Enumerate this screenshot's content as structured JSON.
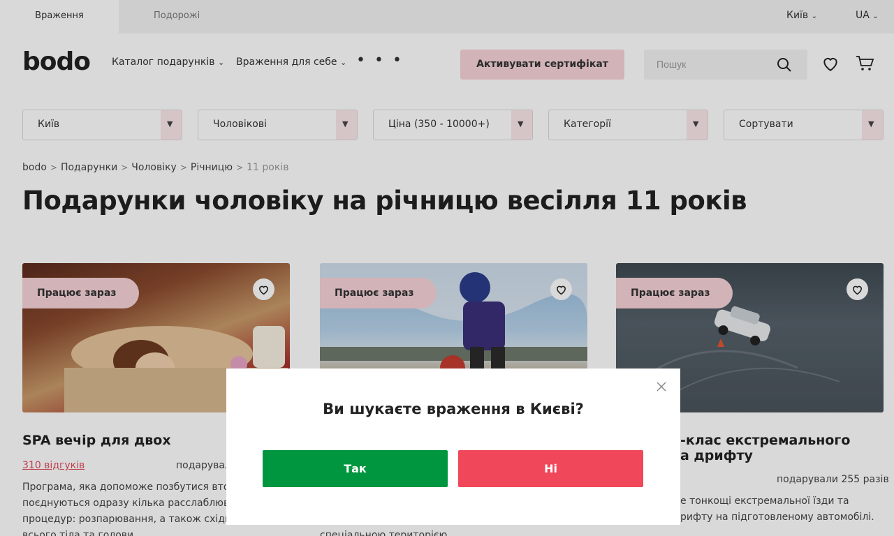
{
  "topbar": {
    "tab_active": "Враження",
    "tab_other": "Подорожі",
    "city": "Київ",
    "lang": "UA"
  },
  "header": {
    "logo": "bodo",
    "nav": [
      {
        "label": "Каталог подарунків"
      },
      {
        "label": "Враження для себе"
      }
    ],
    "more": "• • •",
    "activate": "Активувати сертифікат",
    "search_placeholder": "Пошук"
  },
  "filters": [
    {
      "label": "Київ"
    },
    {
      "label": "Чоловікові"
    },
    {
      "label": "Ціна (350 - 10000+)"
    },
    {
      "label": "Категорії"
    },
    {
      "label": "Сортувати"
    }
  ],
  "breadcrumbs": [
    "bodo",
    "Подарунки",
    "Чоловіку",
    "Річницю",
    "11 років"
  ],
  "page_title": "Подарунки чоловіку на річницю весілля 11 років",
  "cards": [
    {
      "badge": "Працює зараз",
      "title": "SPA вечір для двох",
      "reviews": "310 відгуків",
      "gifted": "подарувал",
      "desc": [
        "Програма, яка допоможе позбутися втоми,",
        "поєднуються одразу кілька расслаблюва",
        "процедур: розпарювання, а також східні",
        "всього тіла та голови"
      ]
    },
    {
      "badge": "Працює зараз",
      "desc": [
        "спеціальною територією"
      ]
    },
    {
      "badge": "Працює зараз",
      "title_lines": [
        "-клас екстремального",
        "а дрифту"
      ],
      "gifted": "подарували 255 разів",
      "desc": [
        "е тонкощі екстремальної їзди та",
        "рифту на підготовленому автомобілі."
      ]
    }
  ],
  "modal": {
    "question": "Ви шукаєте враження в Києві?",
    "yes": "Так",
    "no": "Ні"
  },
  "colors": {
    "accent_pink": "#f7d3d8",
    "yes_green": "#00963f",
    "no_red": "#f0475a"
  }
}
